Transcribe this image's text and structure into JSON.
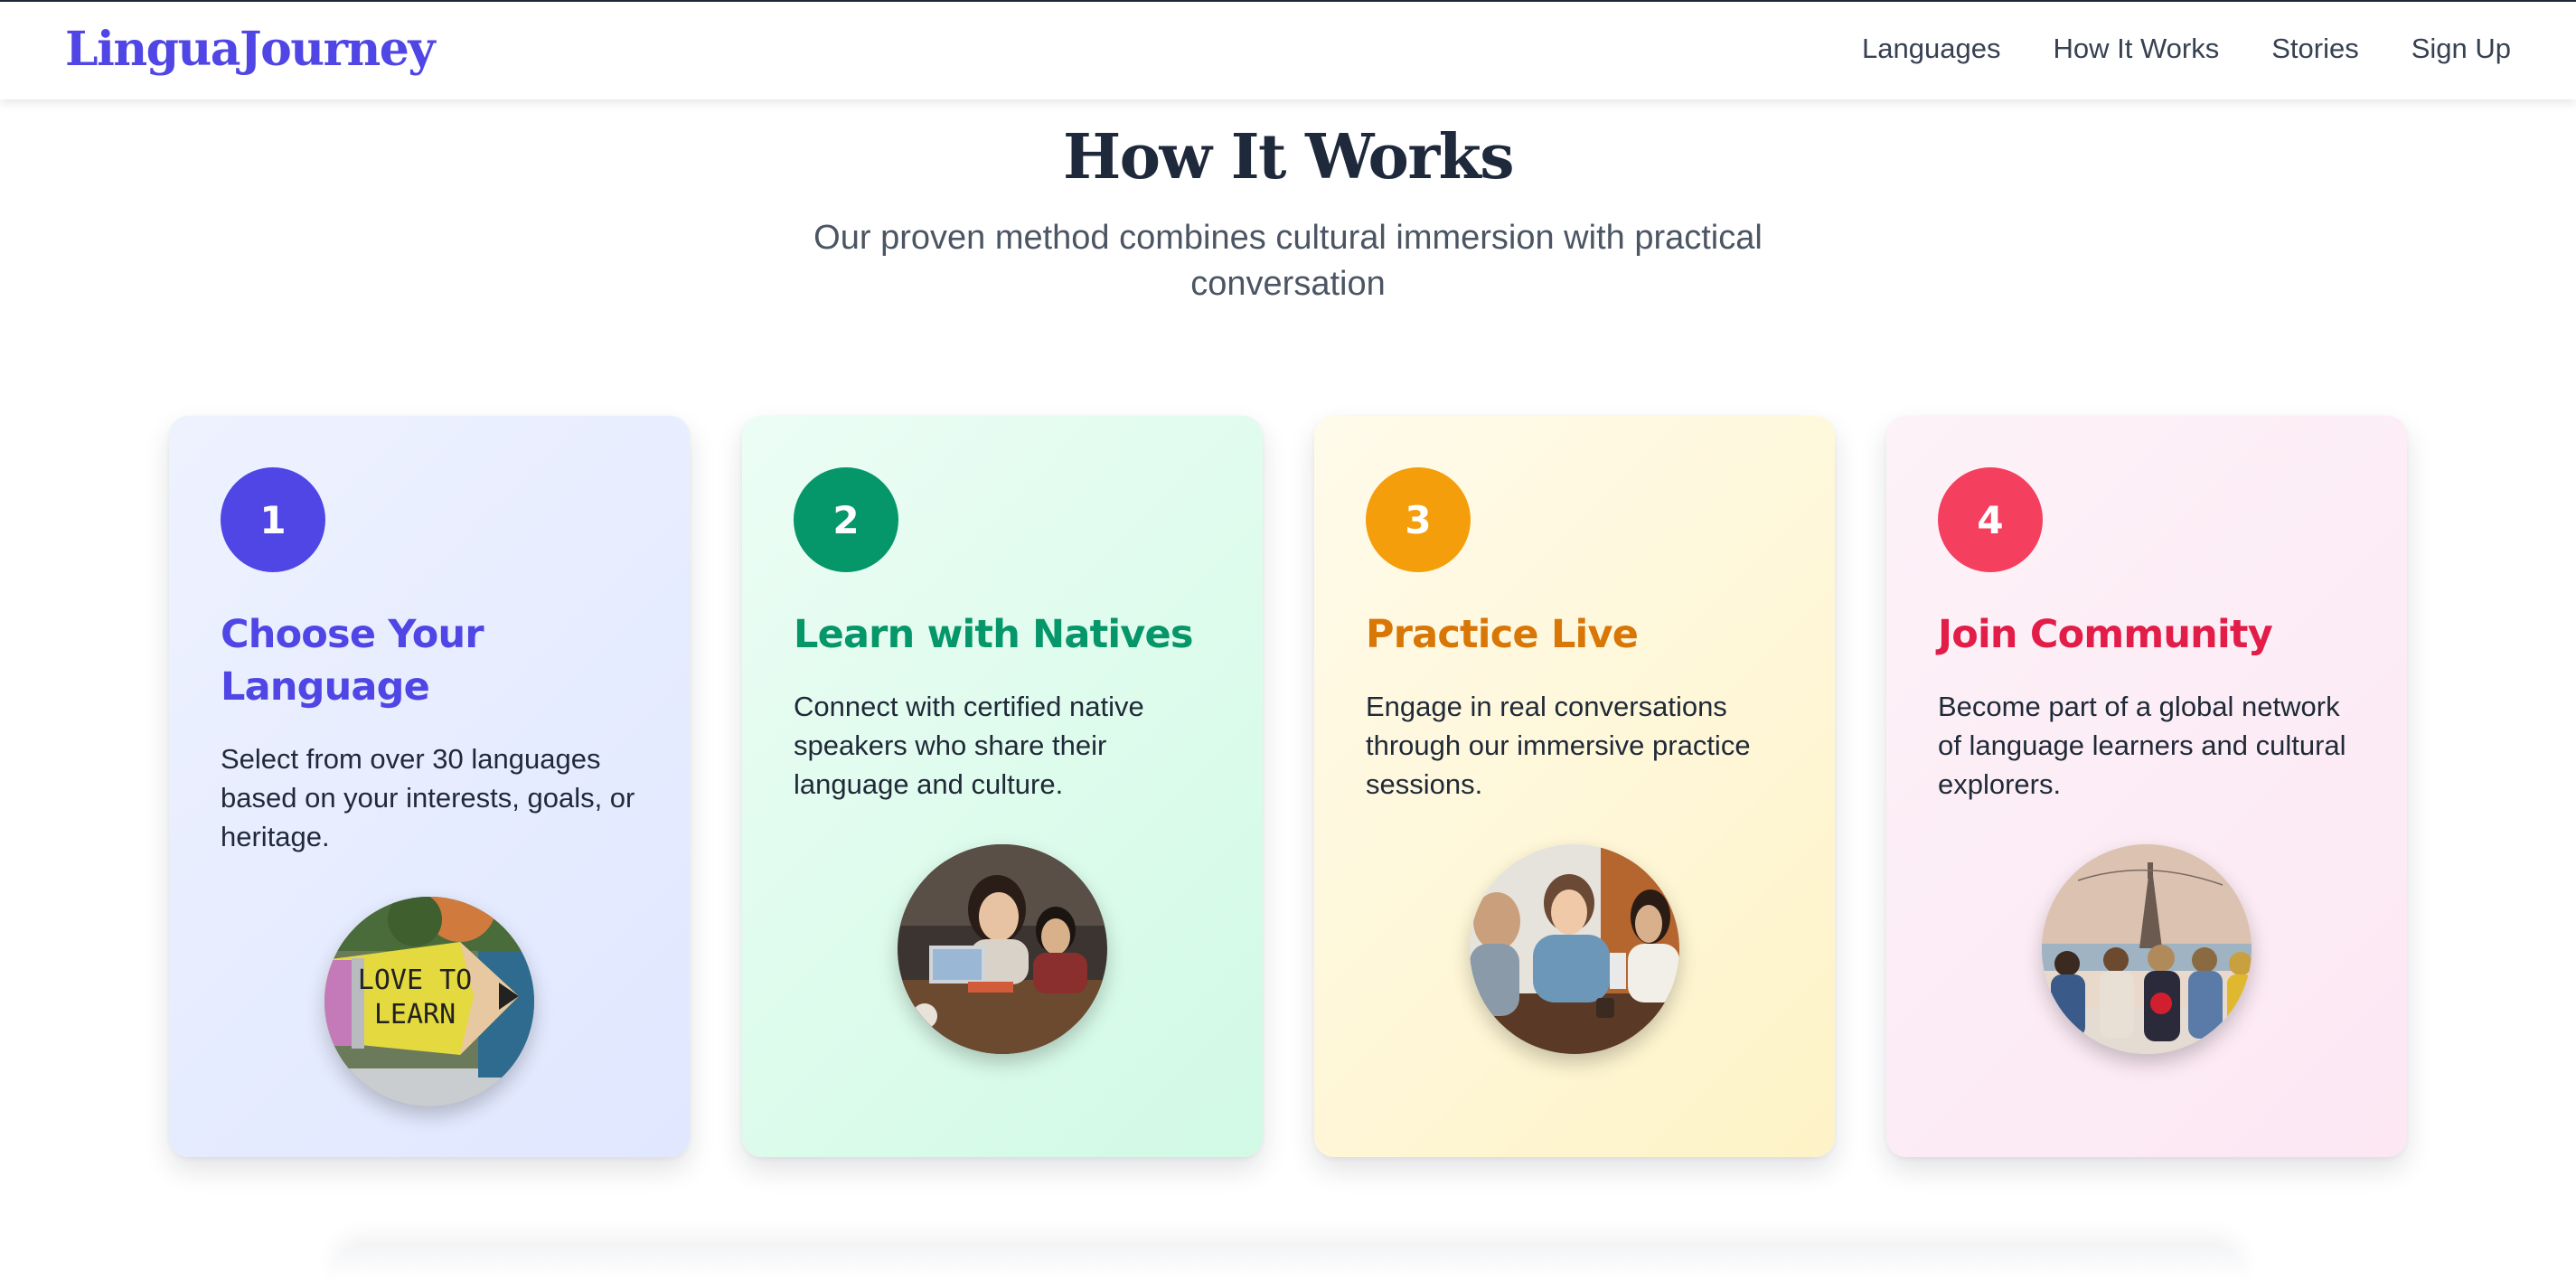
{
  "header": {
    "brand": "LinguaJourney",
    "nav": [
      "Languages",
      "How It Works",
      "Stories",
      "Sign Up"
    ]
  },
  "section": {
    "title": "How It Works",
    "subtitle": "Our proven method combines cultural immersion with practical conversation"
  },
  "steps": [
    {
      "number": "1",
      "title": "Choose Your Language",
      "description": "Select from over 30 languages based on your interests, goals, or heritage.",
      "accent": "#4f46e5",
      "image": "pencil-love-to-learn-photo",
      "image_text": "LOVE TO LEARN"
    },
    {
      "number": "2",
      "title": "Learn with Natives",
      "description": "Connect with certified native speakers who share their language and culture.",
      "accent": "#059669",
      "image": "students-with-laptop-photo"
    },
    {
      "number": "3",
      "title": "Practice Live",
      "description": "Engage in real conversations through our immersive practice sessions.",
      "accent": "#d97706",
      "badge_color": "#f59e0b",
      "image": "friends-conversation-photo"
    },
    {
      "number": "4",
      "title": "Join Community",
      "description": "Become part of a global network of language learners and cultural explorers.",
      "accent": "#e11d48",
      "badge_color": "#f43f5e",
      "image": "travel-group-eiffel-tower-photo"
    }
  ]
}
